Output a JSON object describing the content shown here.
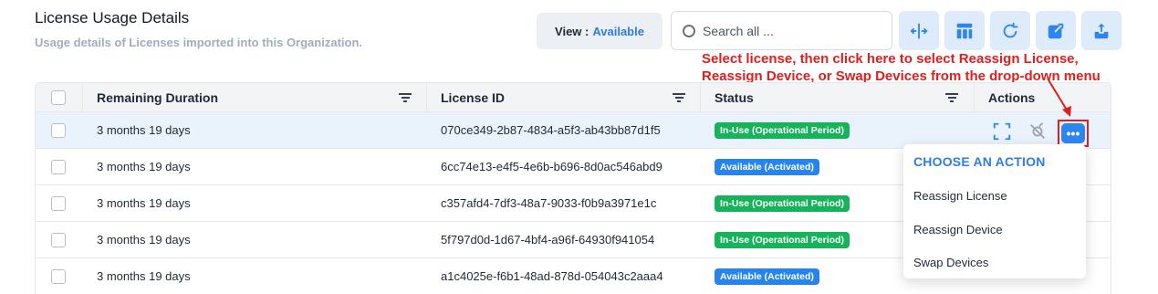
{
  "header": {
    "title": "License Usage Details",
    "subtitle": "Usage details of Licenses imported into this Organization."
  },
  "toolbar": {
    "view_label": "View :",
    "view_value": "Available",
    "search_placeholder": "Search all ...",
    "icons": [
      "split-columns-icon",
      "layout-icon",
      "refresh-icon",
      "export-icon",
      "upload-icon"
    ]
  },
  "annotation": {
    "line1": "Select license, then click here to select Reassign License,",
    "line2": "Reassign Device, or Swap Devices from the drop-down menu"
  },
  "table": {
    "columns": [
      "Remaining Duration",
      "License ID",
      "Status",
      "Actions"
    ],
    "rows": [
      {
        "duration": "3 months 19 days",
        "license_id": "070ce349-2b87-4834-a5f3-ab43bb87d1f5",
        "status": "In-Use (Operational Period)"
      },
      {
        "duration": "3 months 19 days",
        "license_id": "6cc74e13-e4f5-4e6b-b696-8d0ac546abd9",
        "status": "Available (Activated)"
      },
      {
        "duration": "3 months 19 days",
        "license_id": "c357afd4-7df3-48a7-9033-f0b9a3971e1c",
        "status": "In-Use (Operational Period)"
      },
      {
        "duration": "3 months 19 days",
        "license_id": "5f797d0d-1d67-4bf4-a96f-64930f941054",
        "status": "In-Use (Operational Period)"
      },
      {
        "duration": "3 months 19 days",
        "license_id": "a1c4025e-f6b1-48ad-878d-054043c2aaa4",
        "status": "Available (Activated)"
      }
    ]
  },
  "action_menu": {
    "heading": "CHOOSE AN ACTION",
    "items": [
      "Reassign License",
      "Reassign Device",
      "Swap Devices"
    ]
  },
  "colors": {
    "accent": "#2f7de1",
    "in_use": "#17b35a",
    "available": "#2684ec",
    "annotation": "#e11d1d"
  }
}
